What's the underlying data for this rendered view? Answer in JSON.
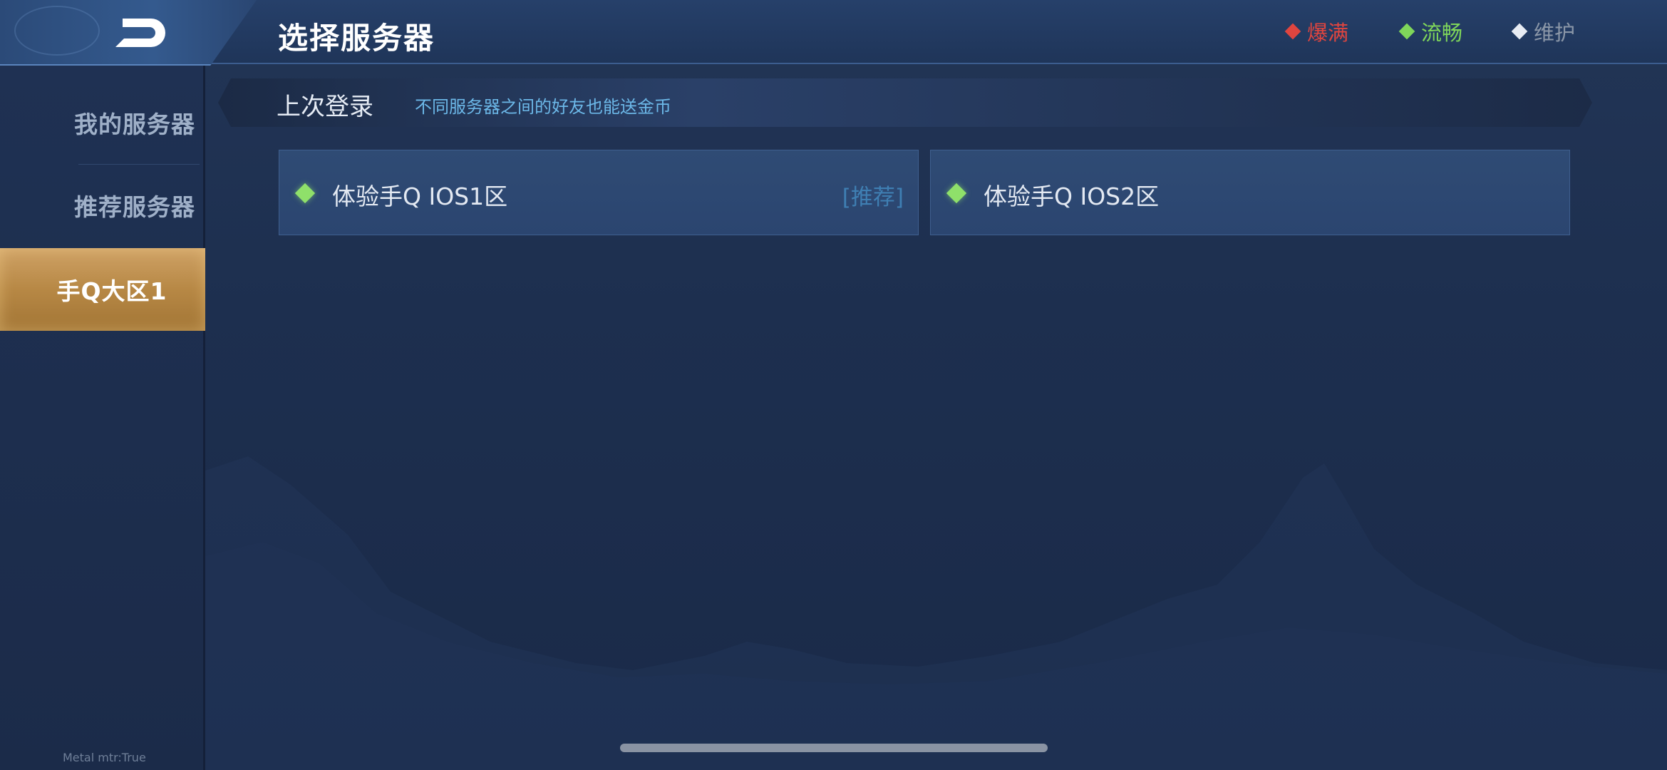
{
  "header": {
    "title": "选择服务器",
    "legend": {
      "full": "爆满",
      "smooth": "流畅",
      "maintenance": "维护"
    }
  },
  "colors": {
    "full": "#e0453f",
    "smooth": "#7fd65a",
    "maintenance": "#e8ecf3",
    "active_tab": "#b78845"
  },
  "sidebar": {
    "items": [
      {
        "label": "我的服务器"
      },
      {
        "label": "推荐服务器"
      },
      {
        "label": "手Q大区1"
      }
    ],
    "selected": "手Q大区1"
  },
  "last_login": {
    "title": "上次登录",
    "hint": "不同服务器之间的好友也能送金币"
  },
  "servers": [
    {
      "name": "体验手Q IOS1区",
      "tag": "[推荐]",
      "status": "smooth"
    },
    {
      "name": "体验手Q IOS2区",
      "status": "smooth"
    }
  ],
  "debug": {
    "metal": "Metal mtr:True"
  }
}
